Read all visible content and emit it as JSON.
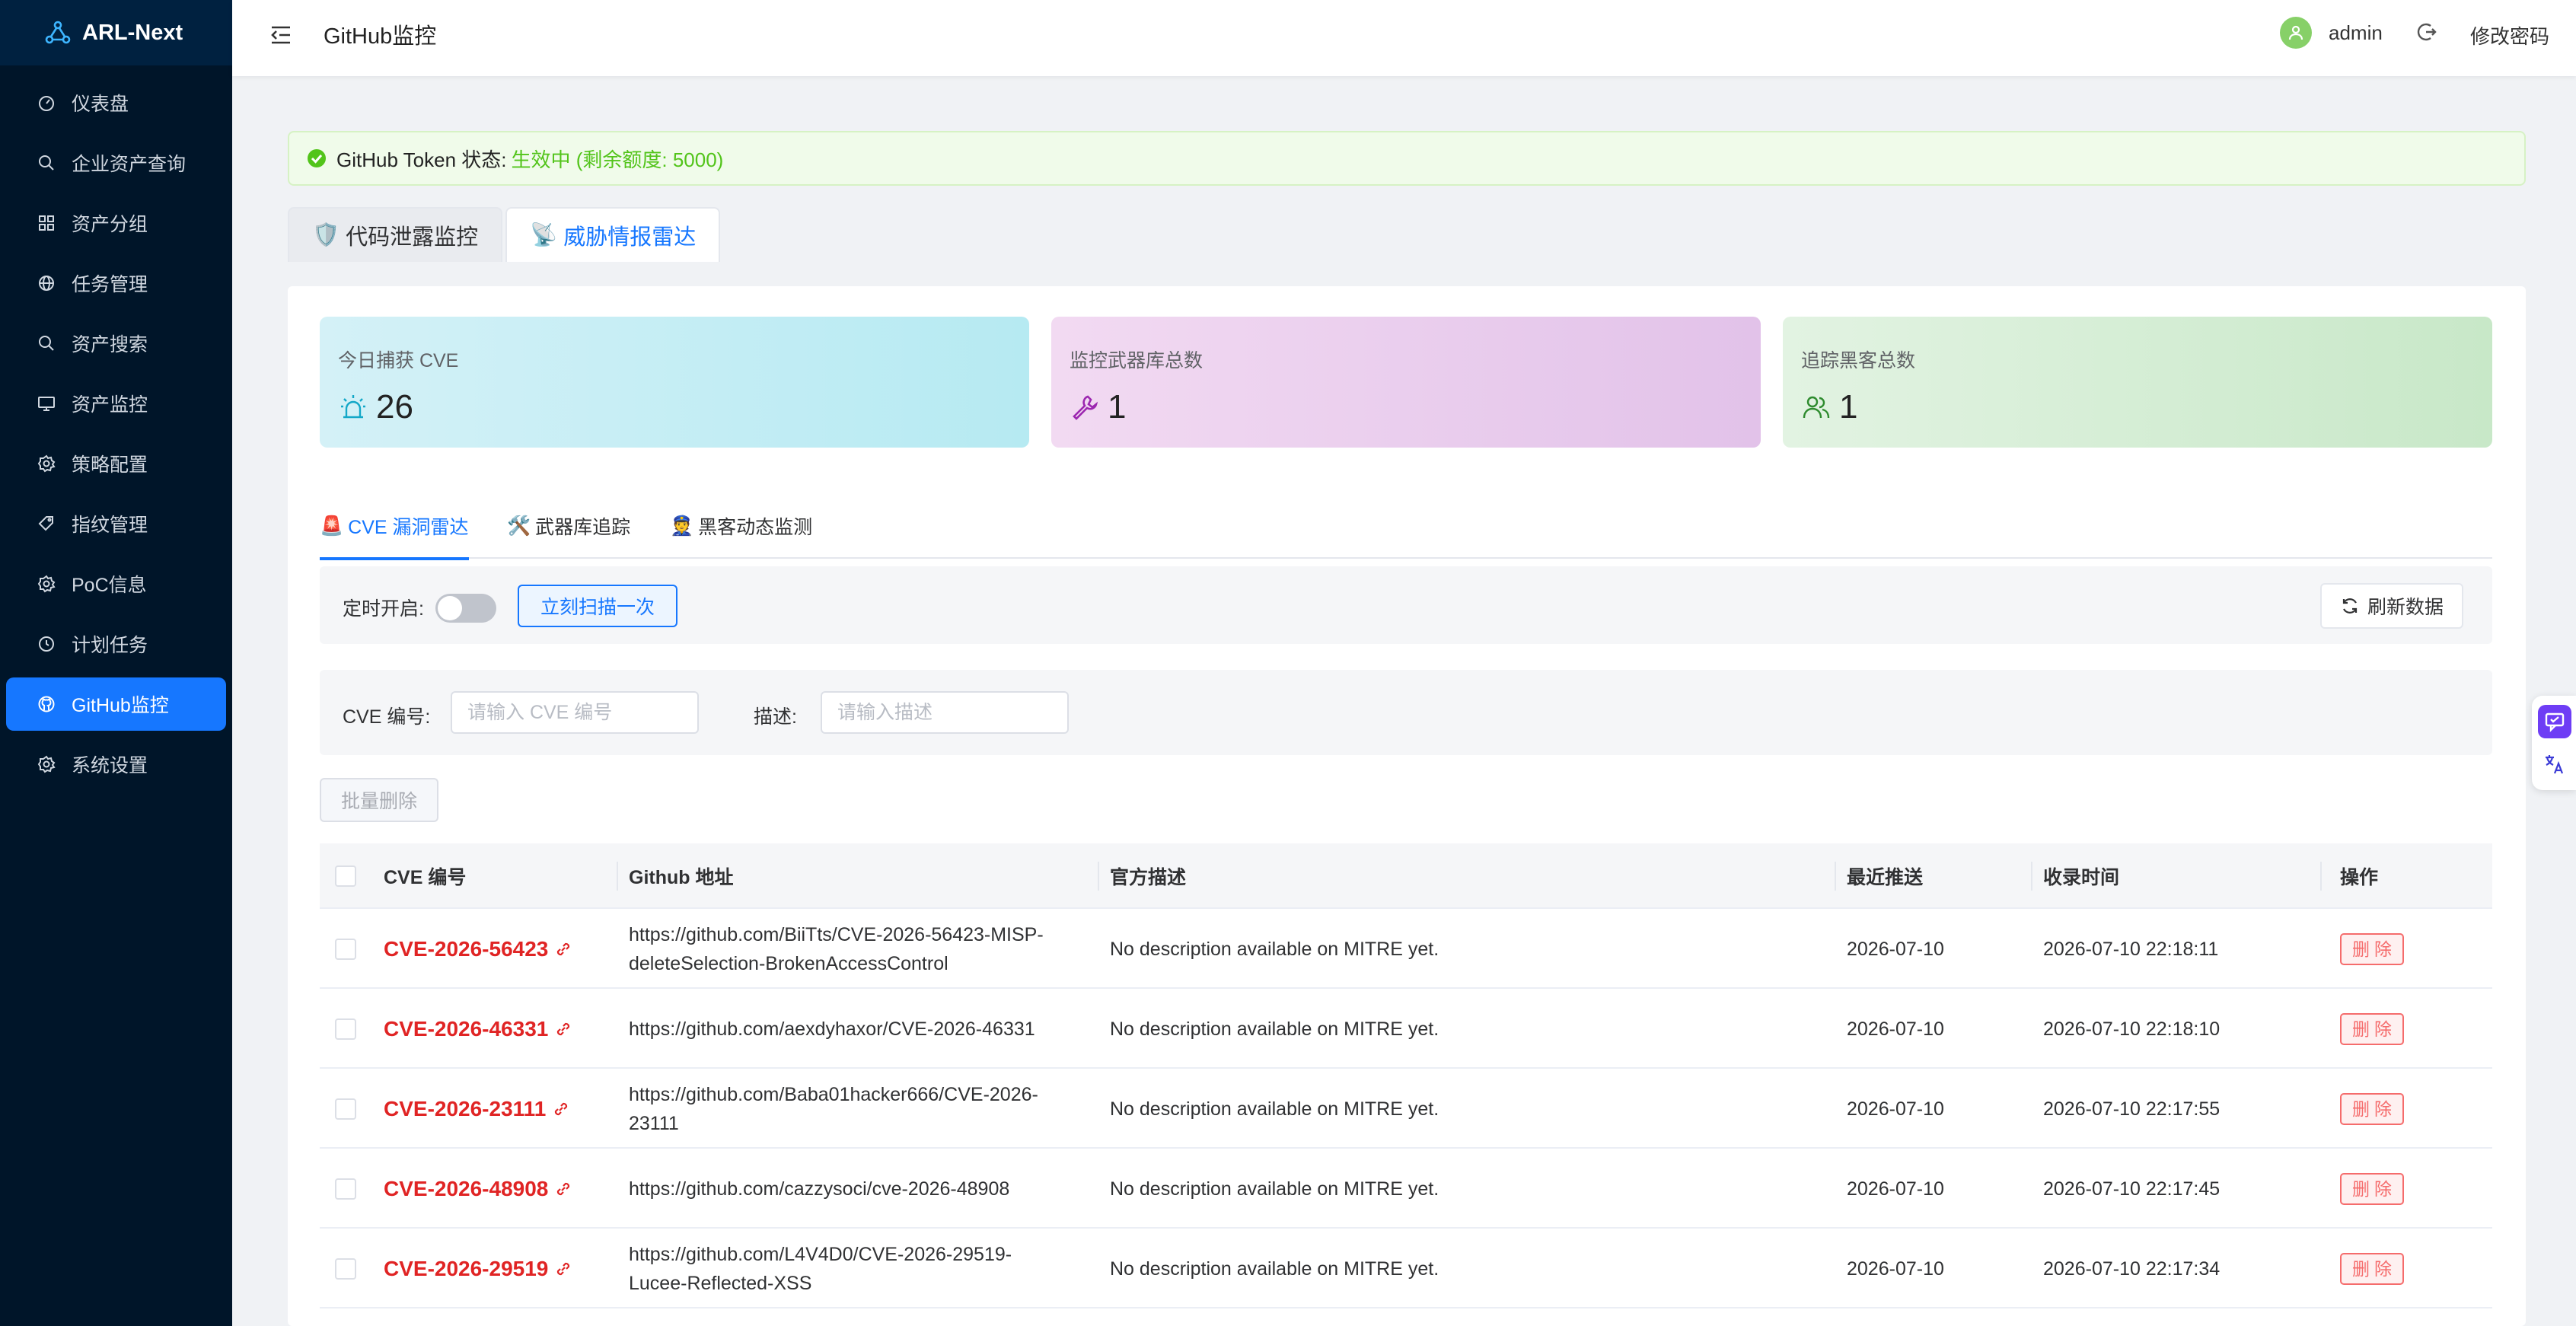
{
  "brand": {
    "title": "ARL-Next",
    "icon": "network-logo-icon"
  },
  "sidebar": {
    "items": [
      {
        "label": "仪表盘",
        "icon": "dashboard-icon",
        "active": false
      },
      {
        "label": "企业资产查询",
        "icon": "search-icon",
        "active": false
      },
      {
        "label": "资产分组",
        "icon": "grid-icon",
        "active": false
      },
      {
        "label": "任务管理",
        "icon": "globe-icon",
        "active": false
      },
      {
        "label": "资产搜索",
        "icon": "search-icon",
        "active": false
      },
      {
        "label": "资产监控",
        "icon": "monitor-icon",
        "active": false
      },
      {
        "label": "策略配置",
        "icon": "gear-icon",
        "active": false
      },
      {
        "label": "指纹管理",
        "icon": "tag-icon",
        "active": false
      },
      {
        "label": "PoC信息",
        "icon": "gear-icon",
        "active": false
      },
      {
        "label": "计划任务",
        "icon": "clock-icon",
        "active": false
      },
      {
        "label": "GitHub监控",
        "icon": "github-icon",
        "active": true
      },
      {
        "label": "系统设置",
        "icon": "gear-icon",
        "active": false
      }
    ]
  },
  "header": {
    "title": "GitHub监控",
    "username": "admin",
    "change_password": "修改密码"
  },
  "alert": {
    "label": "GitHub Token 状态:",
    "status": "生效中 (剩余额度: 5000)"
  },
  "top_tabs": [
    {
      "emoji": "🛡️",
      "label": "代码泄露监控",
      "active": false
    },
    {
      "emoji": "📡",
      "label": "威胁情报雷达",
      "active": true
    }
  ],
  "stats": [
    {
      "label": "今日捕获 CVE",
      "value": "26",
      "icon": "alarm-icon",
      "color": "#13a8c8"
    },
    {
      "label": "监控武器库总数",
      "value": "1",
      "icon": "wrench-icon",
      "color": "#9c27b0"
    },
    {
      "label": "追踪黑客总数",
      "value": "1",
      "icon": "users-icon",
      "color": "#2e8b2e"
    }
  ],
  "sub_tabs": [
    {
      "emoji": "🚨",
      "label": "CVE 漏洞雷达",
      "active": true
    },
    {
      "emoji": "🛠️",
      "label": "武器库追踪",
      "active": false
    },
    {
      "emoji": "👮",
      "label": "黑客动态监测",
      "active": false
    }
  ],
  "toolbar": {
    "schedule_label": "定时开启:",
    "schedule_on": false,
    "scan_button": "立刻扫描一次",
    "refresh_button": "刷新数据"
  },
  "search": {
    "cve_label": "CVE 编号:",
    "cve_placeholder": "请输入 CVE 编号",
    "desc_label": "描述:",
    "desc_placeholder": "请输入描述"
  },
  "batch_delete": "批量删除",
  "table": {
    "columns": [
      "CVE 编号",
      "Github 地址",
      "官方描述",
      "最近推送",
      "收录时间",
      "操作"
    ],
    "rows": [
      {
        "cve": "CVE-2026-56423",
        "github_line1": "https://github.com/BiiTts/CVE-2026-56423-MISP-",
        "github_line2": "deleteSelection-BrokenAccessControl",
        "desc": "No description available on MITRE yet.",
        "pushed": "2026-07-10",
        "collected": "2026-07-10 22:18:11",
        "action": "删除"
      },
      {
        "cve": "CVE-2026-46331",
        "github_line1": "https://github.com/aexdyhaxor/CVE-2026-46331",
        "github_line2": "",
        "desc": "No description available on MITRE yet.",
        "pushed": "2026-07-10",
        "collected": "2026-07-10 22:18:10",
        "action": "删除"
      },
      {
        "cve": "CVE-2026-23111",
        "github_line1": "https://github.com/Baba01hacker666/CVE-2026-",
        "github_line2": "23111",
        "desc": "No description available on MITRE yet.",
        "pushed": "2026-07-10",
        "collected": "2026-07-10 22:17:55",
        "action": "删除"
      },
      {
        "cve": "CVE-2026-48908",
        "github_line1": "https://github.com/cazzysoci/cve-2026-48908",
        "github_line2": "",
        "desc": "No description available on MITRE yet.",
        "pushed": "2026-07-10",
        "collected": "2026-07-10 22:17:45",
        "action": "删除"
      },
      {
        "cve": "CVE-2026-29519",
        "github_line1": "https://github.com/L4V4D0/CVE-2026-29519-",
        "github_line2": "Lucee-Reflected-XSS",
        "desc": "No description available on MITRE yet.",
        "pushed": "2026-07-10",
        "collected": "2026-07-10 22:17:34",
        "action": "删除"
      }
    ]
  },
  "colors": {
    "sidebar_bg": "#001529",
    "accent": "#1677ff",
    "danger": "#e02424",
    "success": "#52c41a"
  }
}
